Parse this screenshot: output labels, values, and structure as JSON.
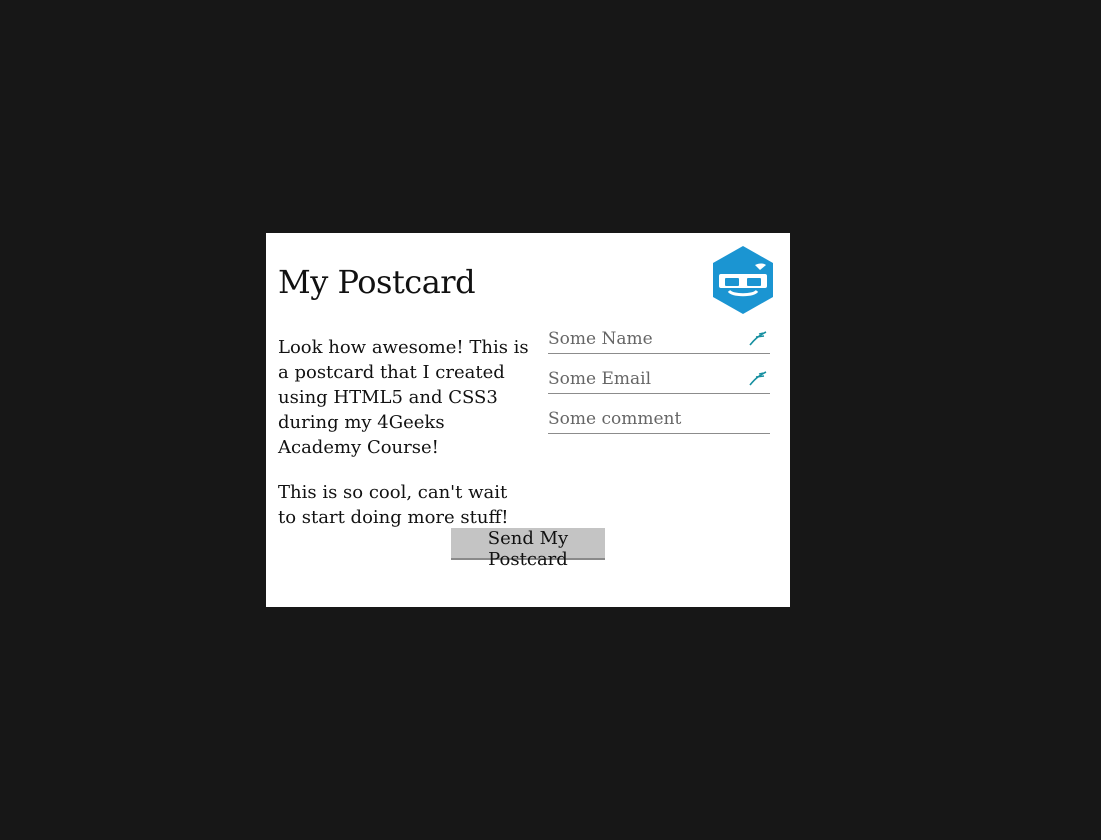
{
  "postcard": {
    "title": "My Postcard",
    "logo_icon": "4geeks-academy-logo-icon",
    "paragraphs": [
      "Look how awesome! This is a postcard that I created using HTML5 and CSS3 during my 4Geeks Academy Course!",
      "This is so cool, can't wait to start doing more stuff!"
    ],
    "fields": [
      {
        "placeholder": "Some Name",
        "value": "",
        "icon": "pen-icon"
      },
      {
        "placeholder": "Some Email",
        "value": "",
        "icon": "pen-icon"
      },
      {
        "placeholder": "Some comment",
        "value": ""
      }
    ],
    "send_label": "Send My Postcard"
  },
  "colors": {
    "background": "#171717",
    "card": "#ffffff",
    "logo": "#1b95d2",
    "button": "#c4c4c4",
    "pen": "#168fa0"
  }
}
